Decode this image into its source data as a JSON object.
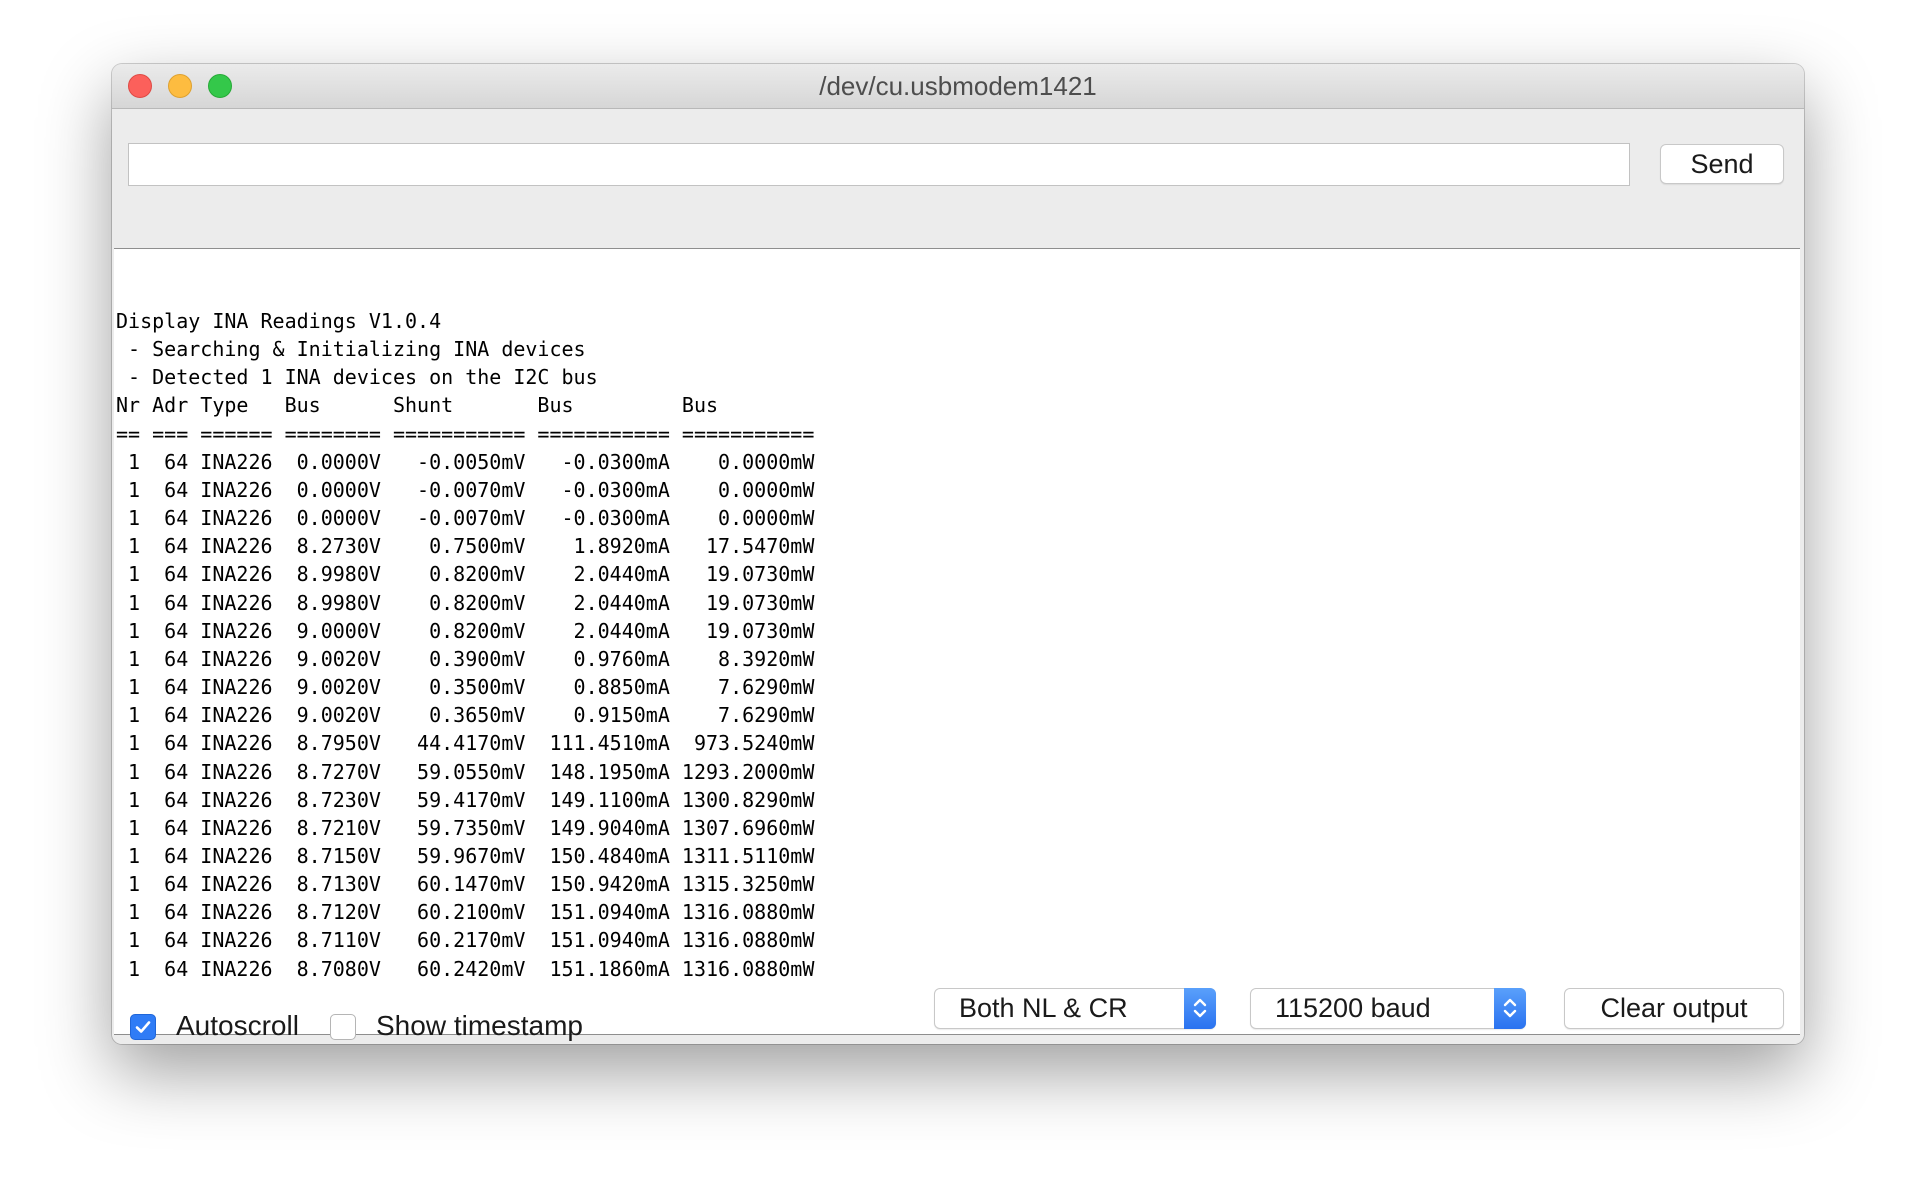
{
  "window": {
    "title": "/dev/cu.usbmodem1421"
  },
  "input_bar": {
    "input_value": "",
    "send_label": "Send"
  },
  "output": {
    "lines": [
      "Display INA Readings V1.0.4",
      " - Searching & Initializing INA devices",
      " - Detected 1 INA devices on the I2C bus",
      "Nr Adr Type   Bus      Shunt       Bus         Bus",
      "== === ====== ======== =========== =========== ===========",
      " 1  64 INA226  0.0000V   -0.0050mV   -0.0300mA    0.0000mW",
      " 1  64 INA226  0.0000V   -0.0070mV   -0.0300mA    0.0000mW",
      " 1  64 INA226  0.0000V   -0.0070mV   -0.0300mA    0.0000mW",
      " 1  64 INA226  8.2730V    0.7500mV    1.8920mA   17.5470mW",
      " 1  64 INA226  8.9980V    0.8200mV    2.0440mA   19.0730mW",
      " 1  64 INA226  8.9980V    0.8200mV    2.0440mA   19.0730mW",
      " 1  64 INA226  9.0000V    0.8200mV    2.0440mA   19.0730mW",
      " 1  64 INA226  9.0020V    0.3900mV    0.9760mA    8.3920mW",
      " 1  64 INA226  9.0020V    0.3500mV    0.8850mA    7.6290mW",
      " 1  64 INA226  9.0020V    0.3650mV    0.9150mA    7.6290mW",
      " 1  64 INA226  8.7950V   44.4170mV  111.4510mA  973.5240mW",
      " 1  64 INA226  8.7270V   59.0550mV  148.1950mA 1293.2000mW",
      " 1  64 INA226  8.7230V   59.4170mV  149.1100mA 1300.8290mW",
      " 1  64 INA226  8.7210V   59.7350mV  149.9040mA 1307.6960mW",
      " 1  64 INA226  8.7150V   59.9670mV  150.4840mA 1311.5110mW",
      " 1  64 INA226  8.7130V   60.1470mV  150.9420mA 1315.3250mW",
      " 1  64 INA226  8.7120V   60.2100mV  151.0940mA 1316.0880mW",
      " 1  64 INA226  8.7110V   60.2170mV  151.0940mA 1316.0880mW",
      " 1  64 INA226  8.7080V   60.2420mV  151.1860mA 1316.0880mW"
    ]
  },
  "bottom_bar": {
    "autoscroll_label": "Autoscroll",
    "autoscroll_checked": true,
    "timestamp_label": "Show timestamp",
    "timestamp_checked": false,
    "line_ending_value": "Both NL & CR",
    "baud_value": "115200 baud",
    "clear_label": "Clear output"
  },
  "colors": {
    "accent_blue": "#2f7cf6",
    "close_red": "#fc605b",
    "minimize_yellow": "#fdbc40",
    "zoom_green": "#34c84a"
  },
  "icons": {
    "check": "checkmark-icon",
    "select_arrows": "up-down-chevron-icon"
  }
}
